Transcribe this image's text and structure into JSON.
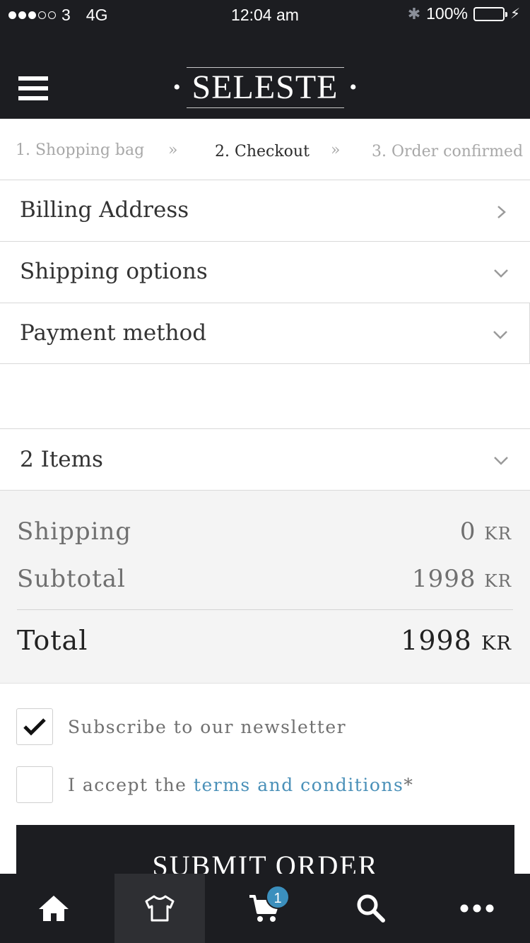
{
  "status_bar": {
    "carrier": "3",
    "network": "4G",
    "time": "12:04 am",
    "battery": "100%"
  },
  "header": {
    "logo": "SELESTE"
  },
  "steps": [
    {
      "label": "1. Shopping bag",
      "state": "done"
    },
    {
      "label": "2. Checkout",
      "state": "active"
    },
    {
      "label": "3. Order confirmed",
      "state": "upcoming"
    }
  ],
  "sections": {
    "billing": "Billing Address",
    "shipping": "Shipping options",
    "payment": "Payment method",
    "items": "2 Items"
  },
  "summary": {
    "shipping_label": "Shipping",
    "shipping_value": "0",
    "subtotal_label": "Subtotal",
    "subtotal_value": "1998",
    "total_label": "Total",
    "total_value": "1998",
    "currency": "KR"
  },
  "options": {
    "newsletter": "Subscribe to our newsletter",
    "newsletter_checked": true,
    "terms_prefix": "I accept the ",
    "terms_link": "terms and conditions",
    "terms_suffix": "*",
    "terms_checked": false
  },
  "submit_label": "SUBMIT ORDER",
  "tabbar": {
    "items": [
      "home-icon",
      "shirt-icon",
      "cart-icon",
      "search-icon",
      "more-icon"
    ],
    "active": "shirt-icon",
    "cart_badge": "1"
  },
  "colors": {
    "dark": "#1c1d21",
    "link": "#4a90b8",
    "badge": "#3b8fbd"
  }
}
